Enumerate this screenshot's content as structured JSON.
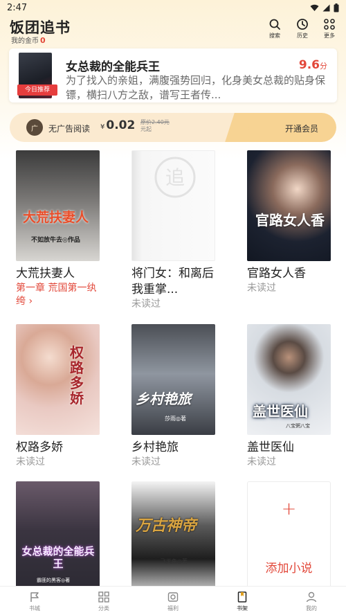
{
  "status_bar": {
    "time": "2:47"
  },
  "header": {
    "title": "饭团追书",
    "coins_label": "我的金币",
    "coins_value": "0",
    "buttons": [
      {
        "icon": "search-icon",
        "label": "搜索"
      },
      {
        "icon": "history-icon",
        "label": "历史"
      },
      {
        "icon": "more-icon",
        "label": "更多"
      }
    ]
  },
  "featured": {
    "badge": "今日推荐",
    "title": "女总裁的全能兵王",
    "score": "9.6",
    "score_unit": "分",
    "description": "为了找入的亲姐，满腹强势回归，化身美女总裁的贴身保镖，横扫八方之敌，谱写王者传..."
  },
  "ad_bar": {
    "label": "无广告阅读",
    "currency": "¥",
    "price": "0.02",
    "original_price": "原价2.40元",
    "price_unit": "元起",
    "cta": "开通会员"
  },
  "books": [
    {
      "title": "大荒扶妻人",
      "status": "第一章 荒国第一纨绔 ›",
      "status_red": true,
      "cover_text": "大荒扶妻人",
      "cover_author": "不如放牛去◎作品",
      "cover_colors": [
        "#3b3b3b",
        "#d8d6d2"
      ]
    },
    {
      "title": "将门女：和离后我重掌...",
      "status": "未读过",
      "status_red": false,
      "cover_text": "",
      "cover_author": "",
      "cover_colors": [
        "#f2f2f2",
        "#e6e6e6"
      ]
    },
    {
      "title": "官路女人香",
      "status": "未读过",
      "status_red": false,
      "cover_text": "官路女人香",
      "cover_author": "",
      "cover_colors": [
        "#1c2230",
        "#3a4456"
      ]
    },
    {
      "title": "权路多娇",
      "status": "未读过",
      "status_red": false,
      "cover_text": "权路多娇",
      "cover_author": "",
      "cover_colors": [
        "#e9c9c2",
        "#f5e2dc"
      ]
    },
    {
      "title": "乡村艳旅",
      "status": "未读过",
      "status_red": false,
      "cover_text": "乡村艳旅",
      "cover_author": "莎雨◎著",
      "cover_colors": [
        "#3a3d44",
        "#8f96a0"
      ]
    },
    {
      "title": "盖世医仙",
      "status": "未读过",
      "status_red": false,
      "cover_text": "盖世医仙",
      "cover_author": "八宝粥八宝",
      "cover_colors": [
        "#d7dce2",
        "#eef0f3"
      ]
    },
    {
      "title": "",
      "status": "",
      "status_red": false,
      "cover_text": "女总裁的全能兵王",
      "cover_author": "霸匪的黑客◎著",
      "cover_colors": [
        "#2c2a33",
        "#6a5a6a"
      ]
    },
    {
      "title": "",
      "status": "",
      "status_red": false,
      "cover_text": "万古神帝",
      "cover_author": "飞天鱼◎著",
      "cover_colors": [
        "#f4f4f4",
        "#cfcfcf"
      ]
    }
  ],
  "add_card": {
    "label": "添加小说"
  },
  "bottom_nav": [
    {
      "icon": "bookstore-icon",
      "label": "书城",
      "active": false
    },
    {
      "icon": "category-icon",
      "label": "分类",
      "active": false
    },
    {
      "icon": "welfare-icon",
      "label": "福利",
      "active": false
    },
    {
      "icon": "bookshelf-icon",
      "label": "书架",
      "active": true
    },
    {
      "icon": "profile-icon",
      "label": "我的",
      "active": false
    }
  ]
}
